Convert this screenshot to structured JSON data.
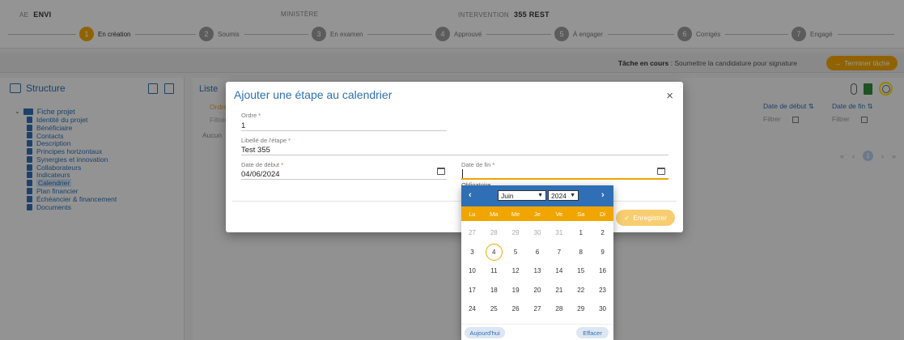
{
  "header": {
    "ae_label": "AE",
    "ae_value": "ENVI",
    "ministere_label": "MINISTÈRE",
    "intervention_label": "INTERVENTION",
    "intervention_value": "355 REST"
  },
  "steps": [
    {
      "num": "1",
      "label": "En création",
      "active": true
    },
    {
      "num": "2",
      "label": "Soumis",
      "active": false
    },
    {
      "num": "3",
      "label": "En examen",
      "active": false
    },
    {
      "num": "4",
      "label": "Approuvé",
      "active": false
    },
    {
      "num": "5",
      "label": "À engager",
      "active": false
    },
    {
      "num": "6",
      "label": "Corrigés",
      "active": false
    },
    {
      "num": "7",
      "label": "Engagé",
      "active": false
    }
  ],
  "task": {
    "prefix": "Tâche en cours",
    "text": " : Soumettre la candidature pour signature",
    "button": "Terminer tâche"
  },
  "structure": {
    "title": "Structure",
    "root": "Fiche projet",
    "items": [
      "Identité du projet",
      "Bénéficiaire",
      "Contacts",
      "Description",
      "Principes horizontaux",
      "Synergies et innovation",
      "Collaborateurs",
      "Indicateurs",
      "Calendrier",
      "Plan financier",
      "Échéancier & financement",
      "Documents"
    ],
    "selected_index": 8
  },
  "main": {
    "title": "Liste",
    "col_ordre": "Ordre",
    "filter_placeholder": "Filtrer",
    "col_date_debut": "Date de début ⇅",
    "col_date_fin": "Date de fin ⇅",
    "empty_text": "Aucun",
    "pager_current": "1"
  },
  "modal": {
    "title": "Ajouter une étape au calendrier",
    "close": "×",
    "ordre_label": "Ordre",
    "ordre_value": "1",
    "libelle_label": "Libellé de l'étape",
    "libelle_value": "Test 355",
    "debut_label": "Date de début",
    "debut_value": "04/06/2024",
    "fin_label": "Date de fin",
    "fin_value": "",
    "required_mark": "*",
    "obligatoire": "Obligatoire",
    "save": "Enregistrer"
  },
  "datepicker": {
    "prev": "‹",
    "next": "›",
    "month": "Juin",
    "year": "2024",
    "weekdays": [
      "Lu",
      "Ma",
      "Me",
      "Je",
      "Ve",
      "Sa",
      "Di"
    ],
    "days": [
      {
        "d": "27",
        "other": true
      },
      {
        "d": "28",
        "other": true
      },
      {
        "d": "29",
        "other": true
      },
      {
        "d": "30",
        "other": true
      },
      {
        "d": "31",
        "other": true
      },
      {
        "d": "1"
      },
      {
        "d": "2"
      },
      {
        "d": "3"
      },
      {
        "d": "4",
        "today": true
      },
      {
        "d": "5"
      },
      {
        "d": "6"
      },
      {
        "d": "7"
      },
      {
        "d": "8"
      },
      {
        "d": "9"
      },
      {
        "d": "10"
      },
      {
        "d": "11"
      },
      {
        "d": "12"
      },
      {
        "d": "13"
      },
      {
        "d": "14"
      },
      {
        "d": "15"
      },
      {
        "d": "16"
      },
      {
        "d": "17"
      },
      {
        "d": "18"
      },
      {
        "d": "19"
      },
      {
        "d": "20"
      },
      {
        "d": "21"
      },
      {
        "d": "22"
      },
      {
        "d": "23"
      },
      {
        "d": "24"
      },
      {
        "d": "25"
      },
      {
        "d": "26"
      },
      {
        "d": "27"
      },
      {
        "d": "28"
      },
      {
        "d": "29"
      },
      {
        "d": "30"
      }
    ],
    "today_btn": "Aujourd'hui",
    "clear_btn": "Effacer"
  },
  "colors": {
    "accent": "#f0a500",
    "primary": "#2f6fb5",
    "highlight_ring": "#f7e000"
  }
}
